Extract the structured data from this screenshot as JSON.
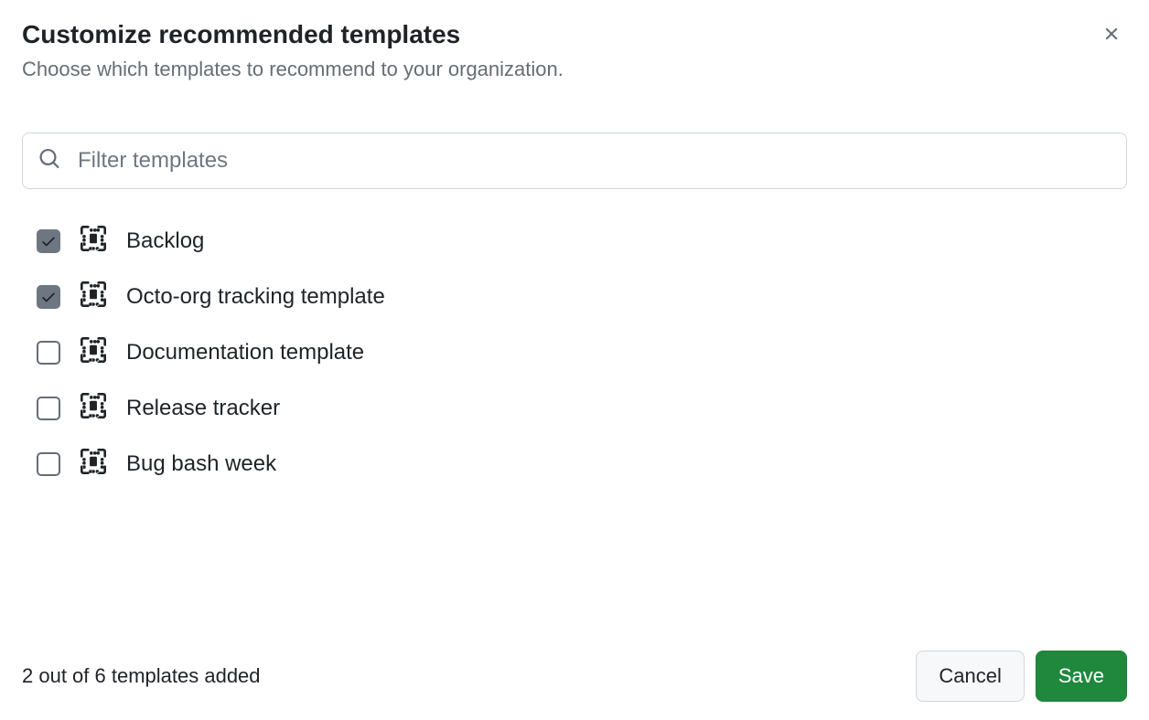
{
  "header": {
    "title": "Customize recommended templates",
    "subtitle": "Choose which templates to recommend to your organization."
  },
  "search": {
    "placeholder": "Filter templates",
    "value": ""
  },
  "templates": [
    {
      "label": "Backlog",
      "checked": true
    },
    {
      "label": "Octo-org tracking template",
      "checked": true
    },
    {
      "label": "Documentation template",
      "checked": false
    },
    {
      "label": "Release tracker",
      "checked": false
    },
    {
      "label": "Bug bash week",
      "checked": false
    }
  ],
  "footer": {
    "status": "2 out of 6 templates added",
    "cancel_label": "Cancel",
    "save_label": "Save"
  }
}
